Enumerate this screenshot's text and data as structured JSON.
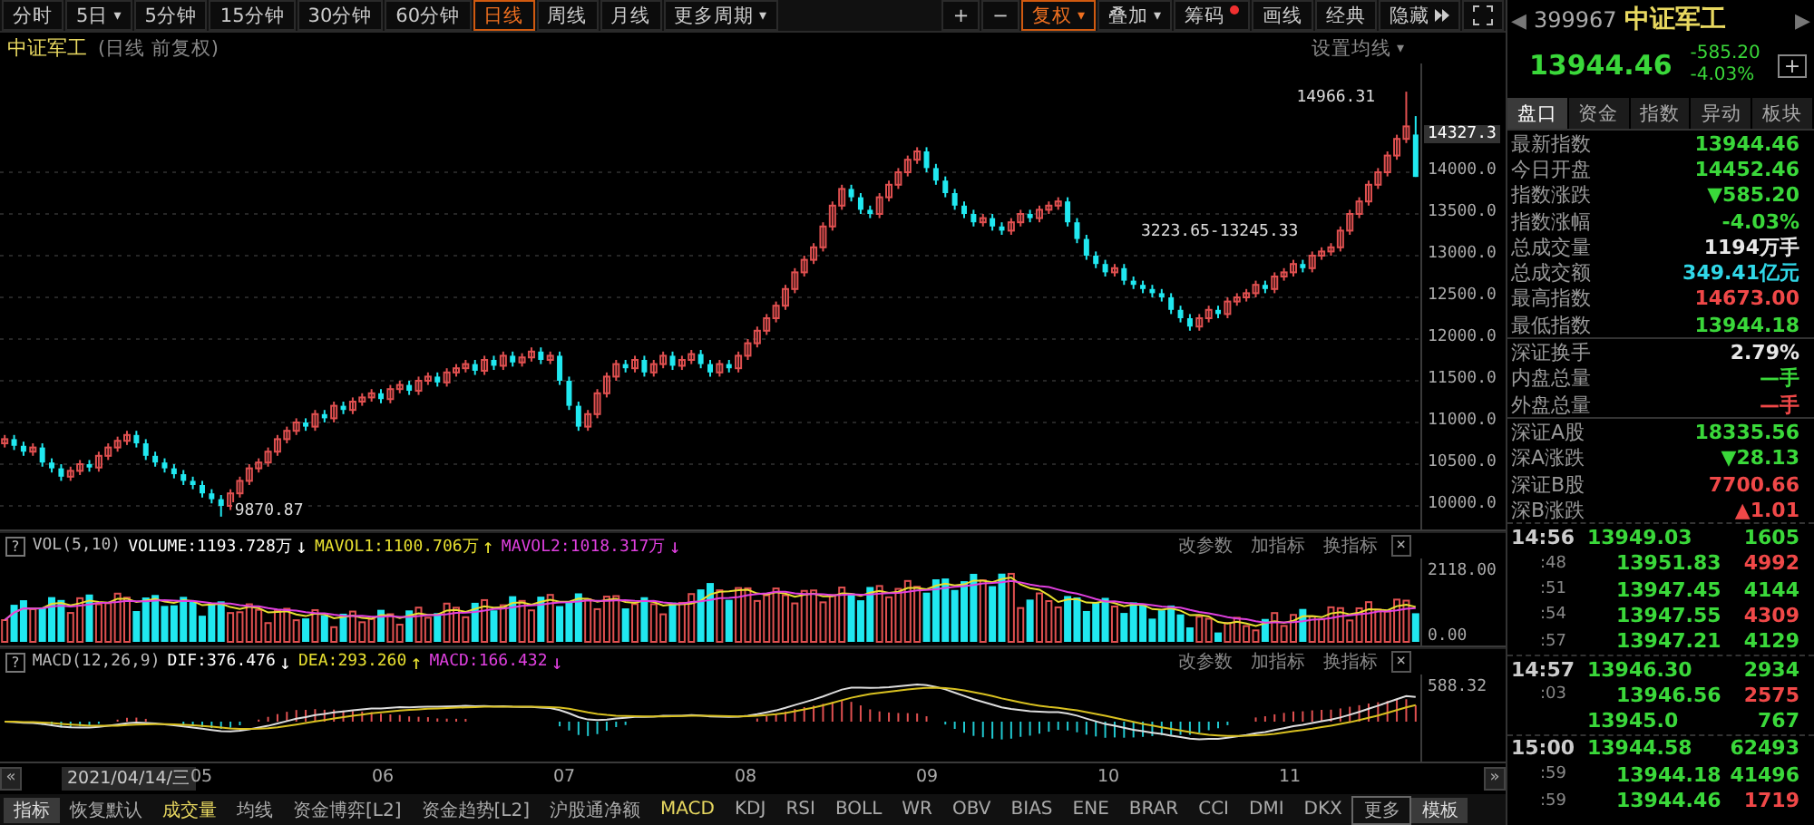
{
  "toolbar": {
    "periods": [
      {
        "label": "分时",
        "selected": false
      },
      {
        "label": "5日",
        "caret": "▾",
        "selected": false
      },
      {
        "label": "5分钟",
        "selected": false
      },
      {
        "label": "15分钟",
        "selected": false
      },
      {
        "label": "30分钟",
        "selected": false
      },
      {
        "label": "60分钟",
        "selected": false
      },
      {
        "label": "日线",
        "selected": true
      },
      {
        "label": "周线",
        "selected": false
      },
      {
        "label": "月线",
        "selected": false
      },
      {
        "label": "更多周期",
        "caret": "▾",
        "selected": false
      }
    ],
    "tools": [
      {
        "label": "+",
        "kind": "plain",
        "selected": false
      },
      {
        "label": "−",
        "kind": "plain",
        "selected": false
      },
      {
        "label": "复权",
        "kind": "dropdown",
        "caret": "▾",
        "selected": true
      },
      {
        "label": "叠加",
        "kind": "dropdown",
        "caret": "▾",
        "selected": false
      },
      {
        "label": "筹码",
        "kind": "dot",
        "selected": false
      },
      {
        "label": "画线",
        "kind": "plain",
        "selected": false
      },
      {
        "label": "经典",
        "kind": "plain",
        "selected": false
      },
      {
        "label": "隐藏",
        "kind": "expand",
        "selected": false
      }
    ]
  },
  "chart": {
    "name": "中证军工",
    "subtitle": "(日线 前复权)",
    "ma_button": "设置均线",
    "ma_caret": "▾",
    "current_price": "14327.3",
    "annotations": [
      {
        "kind": "high",
        "text": "14966.31"
      },
      {
        "kind": "low",
        "text": "9870.87"
      },
      {
        "kind": "range",
        "text": "3223.65-13245.33"
      }
    ],
    "chart_data": {
      "type": "candlestick",
      "ylim": [
        9717.4,
        15304.3
      ],
      "grid": true,
      "yticks": [
        {
          "value": 14000,
          "label": "14000.0"
        },
        {
          "value": 13500,
          "label": "13500.0"
        },
        {
          "value": 13000,
          "label": "13000.0"
        },
        {
          "value": 12500,
          "label": "12500.0"
        },
        {
          "value": 12000,
          "label": "12000.0"
        },
        {
          "value": 11500,
          "label": "11500.0"
        },
        {
          "value": 11000,
          "label": "11000.0"
        },
        {
          "value": 10500,
          "label": "10500.0"
        },
        {
          "value": 10000,
          "label": "10000.0"
        }
      ],
      "ohlc": [
        [
          10750,
          10850,
          10700,
          10800
        ],
        [
          10800,
          10850,
          10670,
          10720
        ],
        [
          10720,
          10770,
          10600,
          10650
        ],
        [
          10650,
          10750,
          10600,
          10700
        ],
        [
          10700,
          10750,
          10470,
          10520
        ],
        [
          10520,
          10570,
          10400,
          10450
        ],
        [
          10450,
          10500,
          10300,
          10350
        ],
        [
          10350,
          10470,
          10300,
          10420
        ],
        [
          10420,
          10550,
          10370,
          10500
        ],
        [
          10500,
          10550,
          10410,
          10460
        ],
        [
          10460,
          10650,
          10410,
          10600
        ],
        [
          10600,
          10750,
          10550,
          10700
        ],
        [
          10700,
          10830,
          10650,
          10780
        ],
        [
          10780,
          10900,
          10730,
          10850
        ],
        [
          10850,
          10900,
          10700,
          10750
        ],
        [
          10750,
          10800,
          10550,
          10600
        ],
        [
          10600,
          10650,
          10470,
          10520
        ],
        [
          10520,
          10570,
          10400,
          10450
        ],
        [
          10450,
          10500,
          10330,
          10380
        ],
        [
          10380,
          10430,
          10250,
          10300
        ],
        [
          10300,
          10350,
          10200,
          10250
        ],
        [
          10250,
          10300,
          10100,
          10150
        ],
        [
          10150,
          10200,
          10030,
          10080
        ],
        [
          10080,
          10130,
          9871,
          10000
        ],
        [
          10000,
          10200,
          9950,
          10150
        ],
        [
          10150,
          10350,
          10100,
          10300
        ],
        [
          10300,
          10500,
          10250,
          10450
        ],
        [
          10450,
          10570,
          10400,
          10520
        ],
        [
          10520,
          10700,
          10470,
          10650
        ],
        [
          10650,
          10850,
          10600,
          10800
        ],
        [
          10800,
          10950,
          10750,
          10900
        ],
        [
          10900,
          11050,
          10850,
          11000
        ],
        [
          11000,
          11050,
          10900,
          10950
        ],
        [
          10950,
          11150,
          10900,
          11100
        ],
        [
          11100,
          11150,
          11000,
          11050
        ],
        [
          11050,
          11250,
          11000,
          11200
        ],
        [
          11200,
          11250,
          11100,
          11150
        ],
        [
          11150,
          11300,
          11100,
          11250
        ],
        [
          11250,
          11350,
          11200,
          11300
        ],
        [
          11300,
          11400,
          11250,
          11350
        ],
        [
          11350,
          11400,
          11230,
          11280
        ],
        [
          11280,
          11450,
          11230,
          11400
        ],
        [
          11400,
          11500,
          11350,
          11450
        ],
        [
          11450,
          11500,
          11330,
          11380
        ],
        [
          11380,
          11550,
          11330,
          11500
        ],
        [
          11500,
          11600,
          11450,
          11550
        ],
        [
          11550,
          11600,
          11430,
          11480
        ],
        [
          11480,
          11650,
          11430,
          11600
        ],
        [
          11600,
          11700,
          11550,
          11650
        ],
        [
          11650,
          11750,
          11600,
          11700
        ],
        [
          11700,
          11750,
          11570,
          11620
        ],
        [
          11620,
          11800,
          11570,
          11750
        ],
        [
          11750,
          11800,
          11630,
          11680
        ],
        [
          11680,
          11850,
          11630,
          11800
        ],
        [
          11800,
          11850,
          11670,
          11720
        ],
        [
          11720,
          11830,
          11670,
          11780
        ],
        [
          11780,
          11900,
          11730,
          11850
        ],
        [
          11850,
          11900,
          11700,
          11750
        ],
        [
          11750,
          11850,
          11700,
          11800
        ],
        [
          11800,
          11850,
          11450,
          11500
        ],
        [
          11500,
          11550,
          11150,
          11200
        ],
        [
          11200,
          11250,
          10900,
          10950
        ],
        [
          10950,
          11150,
          10900,
          11100
        ],
        [
          11100,
          11400,
          11050,
          11350
        ],
        [
          11350,
          11600,
          11300,
          11550
        ],
        [
          11550,
          11750,
          11500,
          11700
        ],
        [
          11700,
          11750,
          11600,
          11650
        ],
        [
          11650,
          11800,
          11600,
          11750
        ],
        [
          11750,
          11800,
          11550,
          11600
        ],
        [
          11600,
          11750,
          11550,
          11700
        ],
        [
          11700,
          11850,
          11650,
          11800
        ],
        [
          11800,
          11850,
          11630,
          11680
        ],
        [
          11680,
          11800,
          11630,
          11750
        ],
        [
          11750,
          11870,
          11700,
          11820
        ],
        [
          11820,
          11870,
          11650,
          11700
        ],
        [
          11700,
          11750,
          11550,
          11600
        ],
        [
          11600,
          11750,
          11550,
          11700
        ],
        [
          11700,
          11750,
          11600,
          11650
        ],
        [
          11650,
          11850,
          11600,
          11800
        ],
        [
          11800,
          12000,
          11750,
          11950
        ],
        [
          11950,
          12150,
          11900,
          12100
        ],
        [
          12100,
          12300,
          12050,
          12250
        ],
        [
          12250,
          12450,
          12200,
          12400
        ],
        [
          12400,
          12650,
          12350,
          12600
        ],
        [
          12600,
          12850,
          12550,
          12800
        ],
        [
          12800,
          13000,
          12750,
          12950
        ],
        [
          12950,
          13150,
          12900,
          13100
        ],
        [
          13100,
          13400,
          13050,
          13350
        ],
        [
          13350,
          13650,
          13300,
          13600
        ],
        [
          13600,
          13850,
          13550,
          13800
        ],
        [
          13800,
          13850,
          13650,
          13700
        ],
        [
          13700,
          13750,
          13500,
          13550
        ],
        [
          13550,
          13600,
          13450,
          13500
        ],
        [
          13500,
          13750,
          13450,
          13700
        ],
        [
          13700,
          13900,
          13650,
          13850
        ],
        [
          13850,
          14050,
          13800,
          14000
        ],
        [
          14000,
          14200,
          13950,
          14150
        ],
        [
          14150,
          14300,
          14100,
          14250
        ],
        [
          14250,
          14300,
          14000,
          14050
        ],
        [
          14050,
          14100,
          13850,
          13900
        ],
        [
          13900,
          13950,
          13700,
          13750
        ],
        [
          13750,
          13800,
          13550,
          13600
        ],
        [
          13600,
          13650,
          13450,
          13500
        ],
        [
          13500,
          13550,
          13350,
          13400
        ],
        [
          13400,
          13500,
          13350,
          13450
        ],
        [
          13450,
          13500,
          13300,
          13350
        ],
        [
          13350,
          13400,
          13250,
          13300
        ],
        [
          13300,
          13450,
          13250,
          13400
        ],
        [
          13400,
          13550,
          13350,
          13500
        ],
        [
          13500,
          13550,
          13400,
          13450
        ],
        [
          13450,
          13600,
          13400,
          13550
        ],
        [
          13550,
          13650,
          13500,
          13600
        ],
        [
          13600,
          13700,
          13550,
          13650
        ],
        [
          13650,
          13700,
          13350,
          13400
        ],
        [
          13400,
          13450,
          13150,
          13200
        ],
        [
          13200,
          13250,
          12950,
          13000
        ],
        [
          13000,
          13050,
          12850,
          12900
        ],
        [
          12900,
          12950,
          12750,
          12800
        ],
        [
          12800,
          12900,
          12750,
          12850
        ],
        [
          12850,
          12900,
          12650,
          12700
        ],
        [
          12700,
          12750,
          12600,
          12650
        ],
        [
          12650,
          12700,
          12550,
          12600
        ],
        [
          12600,
          12650,
          12500,
          12550
        ],
        [
          12550,
          12600,
          12450,
          12500
        ],
        [
          12500,
          12550,
          12300,
          12350
        ],
        [
          12350,
          12400,
          12200,
          12250
        ],
        [
          12250,
          12300,
          12100,
          12150
        ],
        [
          12150,
          12300,
          12100,
          12250
        ],
        [
          12250,
          12400,
          12200,
          12350
        ],
        [
          12350,
          12400,
          12250,
          12300
        ],
        [
          12300,
          12500,
          12250,
          12450
        ],
        [
          12450,
          12550,
          12400,
          12500
        ],
        [
          12500,
          12600,
          12450,
          12550
        ],
        [
          12550,
          12700,
          12500,
          12650
        ],
        [
          12650,
          12700,
          12550,
          12600
        ],
        [
          12600,
          12800,
          12550,
          12750
        ],
        [
          12750,
          12850,
          12700,
          12800
        ],
        [
          12800,
          12950,
          12750,
          12900
        ],
        [
          12900,
          12950,
          12800,
          12850
        ],
        [
          12850,
          13050,
          12800,
          13000
        ],
        [
          13000,
          13100,
          12950,
          13050
        ],
        [
          13050,
          13150,
          13000,
          13100
        ],
        [
          13100,
          13350,
          13050,
          13300
        ],
        [
          13300,
          13550,
          13250,
          13500
        ],
        [
          13500,
          13700,
          13450,
          13650
        ],
        [
          13650,
          13900,
          13600,
          13850
        ],
        [
          13850,
          14050,
          13800,
          14000
        ],
        [
          14000,
          14250,
          13950,
          14200
        ],
        [
          14200,
          14450,
          14150,
          14400
        ],
        [
          14400,
          14966,
          14350,
          14550
        ],
        [
          14452,
          14673,
          13944,
          13944
        ]
      ]
    }
  },
  "panels": [
    {
      "help": "?",
      "name": "VOL(5,10)",
      "values": [
        {
          "text": "VOLUME:1193.728万",
          "arrow": "↓",
          "color": "#ffffff"
        },
        {
          "text": "MAVOL1:1100.706万",
          "arrow": "↑",
          "color": "#e8e030"
        },
        {
          "text": "MAVOL2:1018.317万",
          "arrow": "↓",
          "color": "#e040e0"
        }
      ],
      "actions": [
        "改参数",
        "加指标",
        "换指标"
      ],
      "close": "×",
      "axis": [
        "2118.00",
        "0.00"
      ]
    },
    {
      "help": "?",
      "name": "MACD(12,26,9)",
      "values": [
        {
          "text": "DIF:376.476",
          "arrow": "↓",
          "color": "#ffffff"
        },
        {
          "text": "DEA:293.260",
          "arrow": "↑",
          "color": "#e8e030"
        },
        {
          "text": "MACD:166.432",
          "arrow": "↓",
          "color": "#e040e0"
        }
      ],
      "actions": [
        "改参数",
        "加指标",
        "换指标"
      ],
      "close": "×",
      "axis": [
        "588.32"
      ]
    }
  ],
  "date_axis": {
    "prev": "«",
    "next": "»",
    "cursor_date": "2021/04/14/三",
    "months": [
      "05",
      "06",
      "07",
      "08",
      "09",
      "10",
      "11"
    ]
  },
  "indicator_tabs": [
    {
      "label": "指标",
      "kind": "boxed",
      "selected": false
    },
    {
      "label": "恢复默认",
      "kind": "plain",
      "selected": false
    },
    {
      "label": "成交量",
      "kind": "plain",
      "selected": true
    },
    {
      "label": "均线",
      "kind": "plain",
      "selected": false
    },
    {
      "label": "资金博弈[L2]",
      "kind": "plain",
      "selected": false
    },
    {
      "label": "资金趋势[L2]",
      "kind": "plain",
      "selected": false
    },
    {
      "label": "沪股通净额",
      "kind": "plain",
      "selected": false
    },
    {
      "label": "MACD",
      "kind": "plain",
      "selected": true
    },
    {
      "label": "KDJ",
      "kind": "plain",
      "selected": false
    },
    {
      "label": "RSI",
      "kind": "plain",
      "selected": false
    },
    {
      "label": "BOLL",
      "kind": "plain",
      "selected": false
    },
    {
      "label": "WR",
      "kind": "plain",
      "selected": false
    },
    {
      "label": "OBV",
      "kind": "plain",
      "selected": false
    },
    {
      "label": "BIAS",
      "kind": "plain",
      "selected": false
    },
    {
      "label": "ENE",
      "kind": "plain",
      "selected": false
    },
    {
      "label": "BRAR",
      "kind": "plain",
      "selected": false
    },
    {
      "label": "CCI",
      "kind": "plain",
      "selected": false
    },
    {
      "label": "DMI",
      "kind": "plain",
      "selected": false
    },
    {
      "label": "DKX",
      "kind": "plain",
      "selected": false
    },
    {
      "label": "更多",
      "kind": "outlined",
      "selected": false
    },
    {
      "label": "模板",
      "kind": "boxed",
      "selected": false
    }
  ],
  "quote": {
    "prev": "◀",
    "next": "▶",
    "code": "399967",
    "name": "中证军工",
    "price": "13944.46",
    "change": "-585.20",
    "change_pct": "-4.03%",
    "add": "+",
    "tabs": [
      {
        "label": "盘口",
        "selected": true
      },
      {
        "label": "资金",
        "selected": false
      },
      {
        "label": "指数",
        "selected": false
      },
      {
        "label": "异动",
        "selected": false
      },
      {
        "label": "板块",
        "selected": false
      }
    ],
    "groups": [
      [
        {
          "label": "最新指数",
          "value": "13944.46",
          "color": "#3ad83a"
        },
        {
          "label": "今日开盘",
          "value": "14452.46",
          "color": "#3ad83a"
        },
        {
          "label": "指数涨跌",
          "value": "▼585.20",
          "color": "#3ad83a"
        },
        {
          "label": "指数涨幅",
          "value": "-4.03%",
          "color": "#3ad83a"
        },
        {
          "label": "总成交量",
          "value": "1194",
          "unit": "万手",
          "color": "#e8e8e8"
        },
        {
          "label": "总成交额",
          "value": "349.41",
          "unit": "亿元",
          "color": "#30d8e8"
        },
        {
          "label": "最高指数",
          "value": "14673.00",
          "color": "#f04848"
        },
        {
          "label": "最低指数",
          "value": "13944.18",
          "color": "#3ad83a"
        }
      ],
      [
        {
          "label": "深证换手",
          "value": "2.79%",
          "color": "#e8e8e8"
        },
        {
          "label": "内盘总量",
          "value": "—手",
          "color": "#3ad83a"
        },
        {
          "label": "外盘总量",
          "value": "—手",
          "color": "#f04848"
        }
      ],
      [
        {
          "label": "深证A股",
          "value": "18335.56",
          "color": "#3ad83a"
        },
        {
          "label": "深A涨跌",
          "value": "▼28.13",
          "color": "#3ad83a"
        },
        {
          "label": "深证B股",
          "value": "7700.66",
          "color": "#f04848"
        },
        {
          "label": "深B涨跌",
          "value": "▲1.01",
          "color": "#f04848"
        }
      ]
    ],
    "ticks": [
      [
        {
          "time": "14:56",
          "kind": "minute",
          "price": "13949.03",
          "volume": "1605",
          "color": "#3ad83a"
        },
        {
          "time": ":48",
          "kind": "second",
          "price": "13951.83",
          "volume": "4992",
          "color": "#f04848"
        },
        {
          "time": ":51",
          "kind": "second",
          "price": "13947.45",
          "volume": "4144",
          "color": "#3ad83a"
        },
        {
          "time": ":54",
          "kind": "second",
          "price": "13947.55",
          "volume": "4309",
          "color": "#f04848"
        },
        {
          "time": ":57",
          "kind": "second",
          "price": "13947.21",
          "volume": "4129",
          "color": "#3ad83a"
        }
      ],
      [
        {
          "time": "14:57",
          "kind": "minute",
          "price": "13946.30",
          "volume": "2934",
          "color": "#3ad83a"
        },
        {
          "time": ":03",
          "kind": "second",
          "price": "13946.56",
          "volume": "2575",
          "color": "#f04848"
        },
        {
          "price": "13945.0",
          "volume": "767",
          "color": "#3ad83a"
        }
      ],
      [
        {
          "time": "15:00",
          "kind": "minute",
          "price": "13944.58",
          "volume": "62493",
          "color": "#3ad83a"
        },
        {
          "time": ":59",
          "kind": "second",
          "price": "13944.18",
          "volume": "41496",
          "color": "#3ad83a"
        },
        {
          "time": ":59",
          "kind": "second",
          "price": "13944.46",
          "volume": "1719",
          "color": "#f04848"
        }
      ]
    ]
  }
}
